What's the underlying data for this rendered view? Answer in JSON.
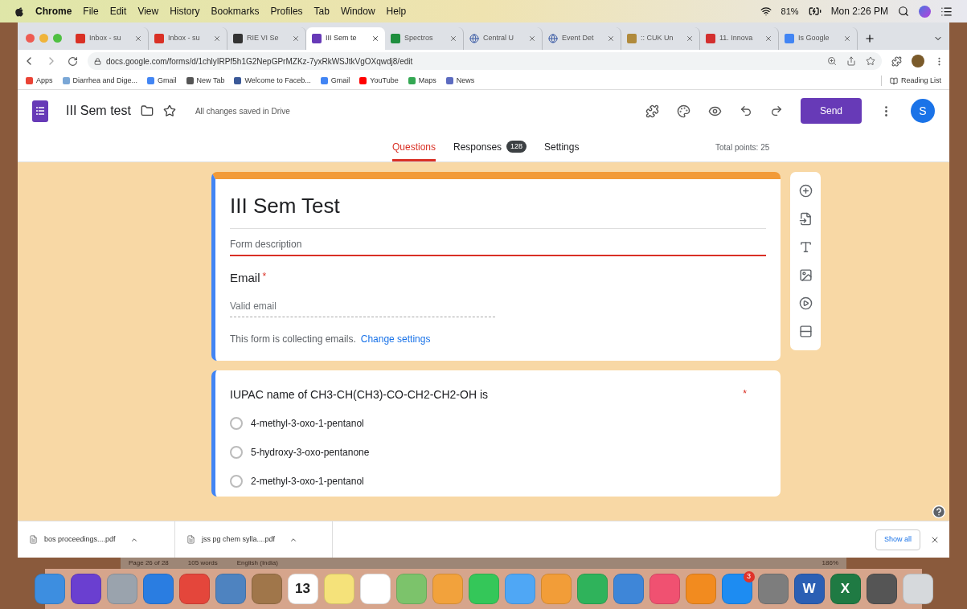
{
  "menu_bar": {
    "app": "Chrome",
    "items": [
      "File",
      "Edit",
      "View",
      "History",
      "Bookmarks",
      "Profiles",
      "Tab",
      "Window",
      "Help"
    ],
    "battery": "81%",
    "clock": "Mon 2:26 PM"
  },
  "browser_tabs": [
    {
      "title": "Inbox - su",
      "kind": "mail",
      "selected": false
    },
    {
      "title": "Inbox - su",
      "kind": "mail",
      "selected": false
    },
    {
      "title": "RIE VI Se",
      "kind": "classroom",
      "selected": false
    },
    {
      "title": "III Sem te",
      "kind": "forms",
      "selected": true
    },
    {
      "title": "Spectros",
      "kind": "drive",
      "selected": false
    },
    {
      "title": "Central U",
      "kind": "globe",
      "selected": false
    },
    {
      "title": "Event Det",
      "kind": "globe",
      "selected": false
    },
    {
      "title": ":: CUK Un",
      "kind": "image",
      "selected": false
    },
    {
      "title": "11. Innova",
      "kind": "red",
      "selected": false
    },
    {
      "title": "Is Google",
      "kind": "diamond",
      "selected": false
    }
  ],
  "address": "docs.google.com/forms/d/1chlyIRPf5h1G2NepGPrMZKz-7yxRkWSJtkVgOXqwdj8/edit",
  "bookmarks": [
    {
      "label": "Apps",
      "kind": "apps"
    },
    {
      "label": "Diarrhea and Dige...",
      "kind": "site"
    },
    {
      "label": "Gmail",
      "kind": "google"
    },
    {
      "label": "New Tab",
      "kind": "globe"
    },
    {
      "label": "Welcome to Faceb...",
      "kind": "facebook"
    },
    {
      "label": "Gmail",
      "kind": "google"
    },
    {
      "label": "YouTube",
      "kind": "youtube"
    },
    {
      "label": "Maps",
      "kind": "maps"
    },
    {
      "label": "News",
      "kind": "news"
    }
  ],
  "reading_list": "Reading List",
  "forms_header": {
    "title": "III Sem test",
    "status": "All changes saved in Drive",
    "send": "Send",
    "avatar": "S"
  },
  "form_tabs": [
    {
      "label": "Questions",
      "selected": true
    },
    {
      "label": "Responses",
      "count": "128",
      "selected": false
    },
    {
      "label": "Settings",
      "selected": false
    }
  ],
  "total_points": "Total points: 25",
  "form": {
    "title": "III Sem Test",
    "description_placeholder": "Form description",
    "email_label": "Email",
    "email_required_mark": "*",
    "email_placeholder": "Valid email",
    "note": "This form is collecting emails.",
    "link": "Change settings"
  },
  "question": {
    "text": "IUPAC name of CH3-CH(CH3)-CO-CH2-CH2-OH is",
    "required_mark": "*",
    "options": [
      {
        "label": "4-methyl-3-oxo-1-pentanol",
        "selected": false
      },
      {
        "label": "5-hydroxy-3-oxo-pentanone",
        "selected": false
      },
      {
        "label": "2-methyl-3-oxo-1-pentanol",
        "selected": false
      }
    ]
  },
  "downloads": [
    "bos proceedings....pdf",
    "jss pg chem sylla....pdf"
  ],
  "show_all": "Show all",
  "word_status": [
    "Page 26 of 28",
    "105 words",
    "English (India)"
  ],
  "word_zoom": "186%",
  "dock": [
    {
      "kind": "finder"
    },
    {
      "kind": "siri"
    },
    {
      "kind": "launchpad"
    },
    {
      "kind": "safari"
    },
    {
      "kind": "chrome"
    },
    {
      "kind": "preview"
    },
    {
      "kind": "contacts"
    },
    {
      "kind": "calendar",
      "label": "13"
    },
    {
      "kind": "notes"
    },
    {
      "kind": "reminders"
    },
    {
      "kind": "maps"
    },
    {
      "kind": "photos"
    },
    {
      "kind": "facetime"
    },
    {
      "kind": "messages"
    },
    {
      "kind": "pages"
    },
    {
      "kind": "numbers"
    },
    {
      "kind": "keynote"
    },
    {
      "kind": "music"
    },
    {
      "kind": "books"
    },
    {
      "kind": "appstore",
      "badge": "3"
    },
    {
      "kind": "settings"
    },
    {
      "kind": "word",
      "label": "W"
    },
    {
      "kind": "excel",
      "label": "X"
    },
    {
      "kind": "photo"
    },
    {
      "kind": "trash"
    }
  ]
}
